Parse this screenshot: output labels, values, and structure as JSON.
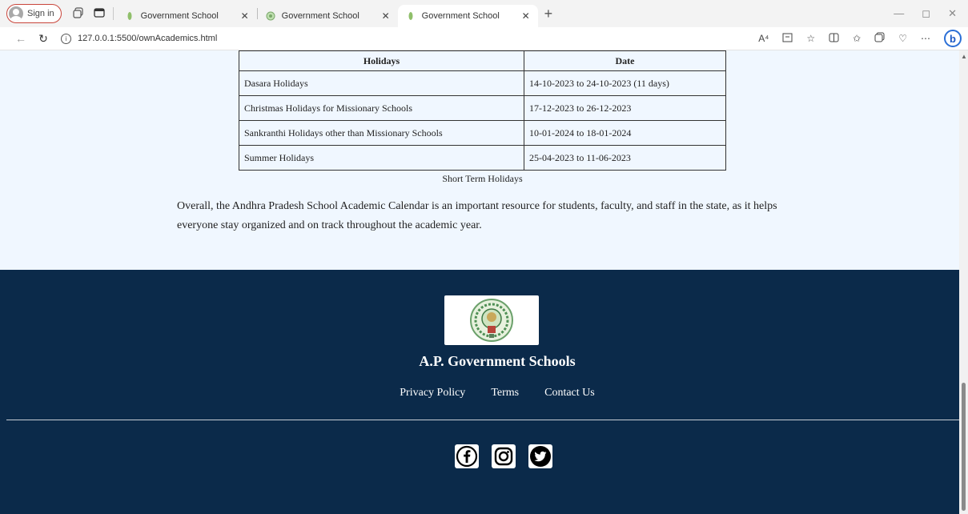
{
  "browser": {
    "signin_label": "Sign in",
    "tabs": [
      {
        "title": "Government School",
        "active": false
      },
      {
        "title": "Government School",
        "active": false
      },
      {
        "title": "Government School",
        "active": true
      }
    ],
    "url": "127.0.0.1:5500/ownAcademics.html",
    "read_aloud_label": "A⁴",
    "new_tab_glyph": "+",
    "close_glyph": "✕",
    "more_glyph": "⋯",
    "bing_glyph": "b"
  },
  "holiday_table": {
    "headers": [
      "Holidays",
      "Date"
    ],
    "rows": [
      {
        "name": "Dasara Holidays",
        "date": "14-10-2023 to 24-10-2023 (11 days)"
      },
      {
        "name": "Christmas Holidays for Missionary Schools",
        "date": "17-12-2023 to 26-12-2023"
      },
      {
        "name": "Sankranthi Holidays other than Missionary Schools",
        "date": "10-01-2024 to 18-01-2024"
      },
      {
        "name": "Summer Holidays",
        "date": "25-04-2023 to 11-06-2023"
      }
    ],
    "caption": "Short Term Holidays"
  },
  "summary": "Overall, the Andhra Pradesh School Academic Calendar is an important resource for students, faculty, and staff in the state, as it helps everyone stay organized and on track throughout the academic year.",
  "footer": {
    "org_name": "A.P. Government Schools",
    "links": [
      "Privacy Policy",
      "Terms",
      "Contact Us"
    ],
    "social": [
      "facebook-icon",
      "instagram-icon",
      "twitter-icon"
    ],
    "colors": {
      "footer_bg": "#0b2a4a",
      "content_bg": "#f0f7ff"
    }
  }
}
